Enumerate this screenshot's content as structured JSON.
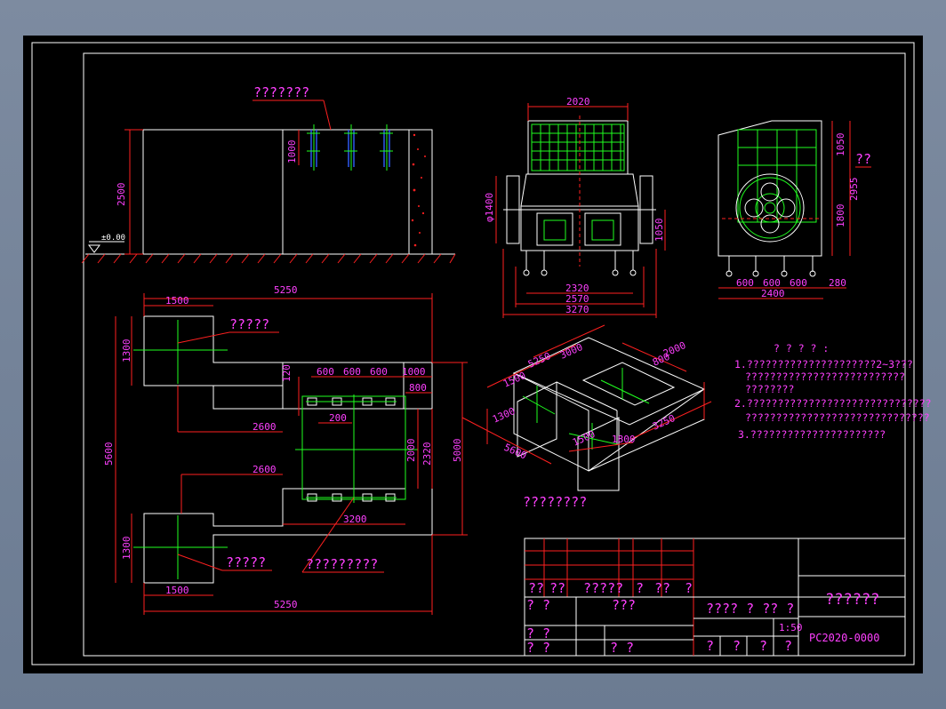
{
  "labels": {
    "top_callout": "???????",
    "callout_left_top": "?????",
    "callout_left_bottom": "?????",
    "callout_mid_bottom": "?????????",
    "iso_caption": "????????",
    "side_qq": "??",
    "ground_level": "±0.00"
  },
  "dims": {
    "elev_2500": "2500",
    "elev_1000": "1000",
    "front_2020": "2020",
    "front_phi1400": "φ1400",
    "front_1050": "1050",
    "front_2320": "2320",
    "front_2570": "2570",
    "front_3270": "3270",
    "side_1050": "1050",
    "side_1800": "1800",
    "side_2955": "2955",
    "side_600a": "600",
    "side_600b": "600",
    "side_600c": "600",
    "side_280": "280",
    "side_2400": "2400",
    "plan_5250_top": "5250",
    "plan_1500_top": "1500",
    "plan_1300_top": "1300",
    "plan_600_1": "600",
    "plan_600_2": "600",
    "plan_600_3": "600",
    "plan_1000": "1000",
    "plan_120": "120",
    "plan_800": "800",
    "plan_200": "200",
    "plan_2600_a": "2600",
    "plan_5600": "5600",
    "plan_2000": "2000",
    "plan_2320": "2320",
    "plan_5000": "5000",
    "plan_2600_b": "2600",
    "plan_3200": "3200",
    "plan_1300_bot": "1300",
    "plan_1500_bot": "1500",
    "plan_5250_bot": "5250",
    "iso_5250": "5250",
    "iso_3000": "3000",
    "iso_2000": "2000",
    "iso_1500": "1500",
    "iso_1300": "1300",
    "iso_5600": "5600",
    "iso_1500b": "1500",
    "iso_3250": "3250",
    "iso_800": "800",
    "iso_1800": "1800"
  },
  "notes": {
    "heading": "? ? ? ? :",
    "line1": "1.?????????????????????2~3???",
    "line1b": "??????????????????????????",
    "line1c": "????????",
    "line2": "2.??????????????????????????????",
    "line2b": "??????????????????????????????",
    "line3": "3.??????????????????????"
  },
  "title_block": {
    "row1": [
      "??",
      "??",
      "?????",
      "?",
      "??",
      "?"
    ],
    "row2_left": "?  ?",
    "row2_mid": "???",
    "row2_right": "????  ?    ??   ?",
    "scale": "1:50",
    "row3_left": "?  ?",
    "row4_left": "?  ?",
    "row4_mid": "?  ?",
    "row4_right": [
      "?",
      "?",
      "?",
      "?"
    ],
    "drawing_title": "??????",
    "drawing_no": "PC2020-0000"
  }
}
